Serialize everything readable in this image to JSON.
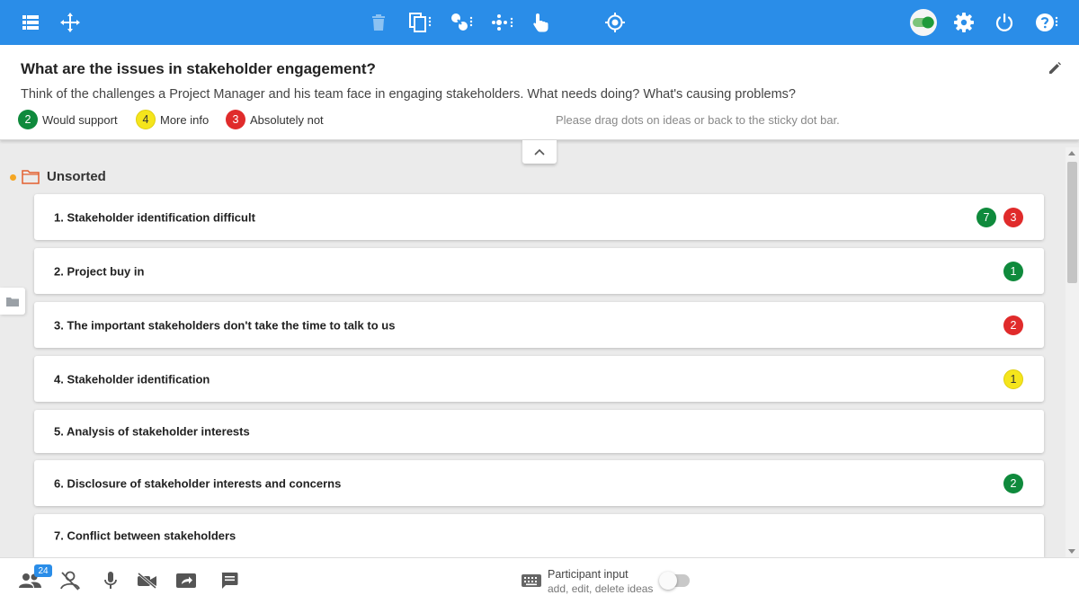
{
  "toolbar": {
    "icons": [
      "list-view-icon",
      "move-icon",
      "delete-icon",
      "copy-icon",
      "link-icon",
      "dots-icon",
      "hand-pointer-icon",
      "target-icon",
      "toggle-icon",
      "gear-icon",
      "power-icon",
      "help-icon"
    ],
    "accent": "#2a8de8"
  },
  "question": {
    "title": "What are the issues in stakeholder engagement?",
    "description": "Think of the challenges a Project Manager and his team face in engaging stakeholders. What needs doing? What's causing problems?"
  },
  "legend": [
    {
      "count": "2",
      "label": "Would support",
      "color": "green"
    },
    {
      "count": "4",
      "label": "More info",
      "color": "yellow"
    },
    {
      "count": "3",
      "label": "Absolutely not",
      "color": "red"
    }
  ],
  "drag_hint": "Please drag dots on ideas or back to the sticky dot bar.",
  "group": {
    "title": "Unsorted"
  },
  "ideas": [
    {
      "text": "1. Stakeholder identification difficult",
      "dots": [
        {
          "color": "green",
          "count": "7"
        },
        {
          "color": "red",
          "count": "3"
        }
      ]
    },
    {
      "text": "2. Project buy in",
      "dots": [
        {
          "color": "green",
          "count": "1"
        }
      ]
    },
    {
      "text": "3. The important stakeholders don't take the time to talk to us",
      "dots": [
        {
          "color": "red",
          "count": "2"
        }
      ]
    },
    {
      "text": "4. Stakeholder identification",
      "dots": [
        {
          "color": "yellow",
          "count": "1"
        }
      ]
    },
    {
      "text": "5. Analysis of stakeholder interests",
      "dots": []
    },
    {
      "text": "6. Disclosure of stakeholder interests and concerns",
      "dots": [
        {
          "color": "green",
          "count": "2"
        }
      ]
    },
    {
      "text": "7. Conflict between stakeholders",
      "dots": []
    }
  ],
  "bottom": {
    "participant_count": "24",
    "participant_input_label": "Participant input",
    "participant_input_sub": "add, edit, delete ideas"
  }
}
